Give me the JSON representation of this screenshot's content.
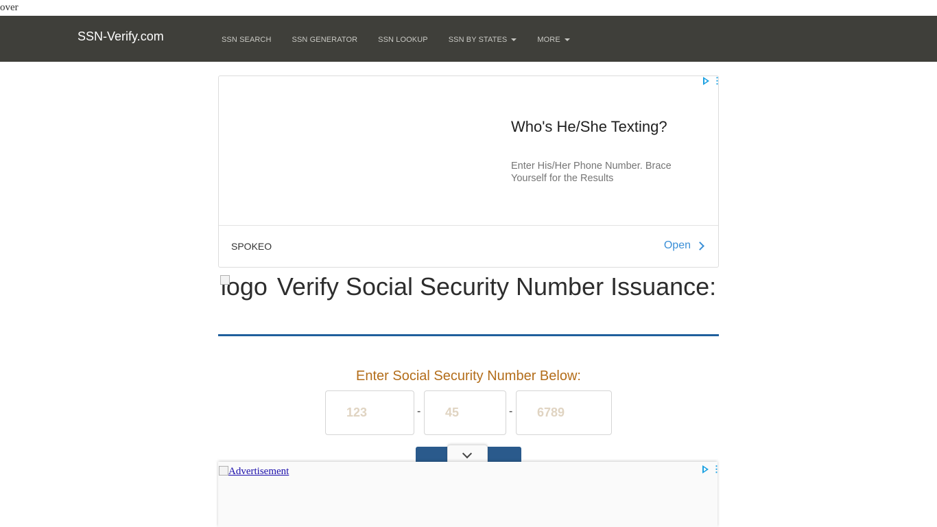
{
  "stray_text": "over",
  "navbar": {
    "brand": "SSN-Verify.com",
    "items": [
      {
        "label": "SSN SEARCH",
        "dropdown": false
      },
      {
        "label": "SSN GENERATOR",
        "dropdown": false
      },
      {
        "label": "SSN LOOKUP",
        "dropdown": false
      },
      {
        "label": "SSN BY STATES",
        "dropdown": true
      },
      {
        "label": "MORE",
        "dropdown": true
      }
    ]
  },
  "ad_top": {
    "headline": "Who's He/She Texting?",
    "body": "Enter His/Her Phone Number. Brace Yourself for the Results",
    "advertiser": "SPOKEO",
    "cta": "Open"
  },
  "title": {
    "logo_alt": "logo",
    "text": "Verify Social Security Number Issuance:"
  },
  "form": {
    "label": "Enter Social Security Number Below:",
    "fields": [
      {
        "placeholder": "123",
        "value": ""
      },
      {
        "placeholder": "45",
        "value": ""
      },
      {
        "placeholder": "6789",
        "value": ""
      }
    ],
    "separator": "-"
  },
  "ad_bottom": {
    "alt_text": "Advertisement"
  },
  "colors": {
    "navbar_bg": "#3f3f3a",
    "accent_blue": "#1f5f9c",
    "label_orange": "#b36d1a",
    "ad_link_blue": "#3a8fd7"
  }
}
